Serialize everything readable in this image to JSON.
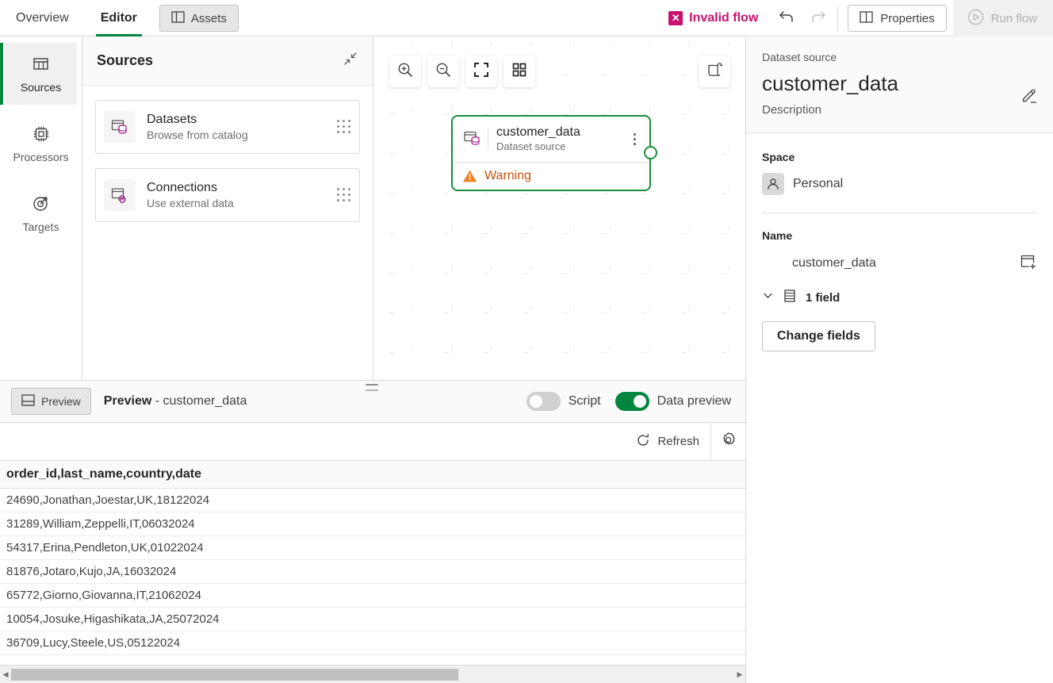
{
  "topbar": {
    "tabs": [
      {
        "label": "Overview",
        "active": false
      },
      {
        "label": "Editor",
        "active": true
      }
    ],
    "assets_label": "Assets",
    "invalid_flow_label": "Invalid flow",
    "invalid_flow_color": "#C8106E",
    "undo_label": "Undo",
    "redo_label": "Redo",
    "properties_label": "Properties",
    "run_flow_label": "Run flow"
  },
  "rail": {
    "items": [
      {
        "label": "Sources",
        "icon": "table-icon",
        "active": true
      },
      {
        "label": "Processors",
        "icon": "chip-icon",
        "active": false
      },
      {
        "label": "Targets",
        "icon": "target-icon",
        "active": false
      }
    ]
  },
  "sources_panel": {
    "title": "Sources",
    "collapse_label": "Collapse",
    "cards": [
      {
        "title": "Datasets",
        "subtitle": "Browse from catalog",
        "icon": "dataset-icon"
      },
      {
        "title": "Connections",
        "subtitle": "Use external data",
        "icon": "connection-icon"
      }
    ]
  },
  "canvas": {
    "toolbar": [
      {
        "name": "zoom-in-icon",
        "label": "Zoom in"
      },
      {
        "name": "zoom-out-icon",
        "label": "Zoom out"
      },
      {
        "name": "fit-screen-icon",
        "label": "Fit to screen"
      },
      {
        "name": "auto-layout-icon",
        "label": "Auto layout"
      }
    ],
    "script_button_label": "Script",
    "node": {
      "title": "customer_data",
      "subtitle": "Dataset source",
      "status": "Warning",
      "status_color": "#C4500F",
      "border_color": "#1A8C3C",
      "menu_label": "More options"
    }
  },
  "preview": {
    "tab_label": "Preview",
    "title_prefix": "Preview",
    "title_suffix": "- customer_data",
    "script_toggle_label": "Script",
    "script_toggle_on": false,
    "data_preview_toggle_label": "Data preview",
    "data_preview_toggle_on": true,
    "refresh_label": "Refresh",
    "settings_label": "Settings",
    "table": {
      "header": "order_id,last_name,country,date",
      "rows": [
        "24690,Jonathan,Joestar,UK,18122024",
        "31289,William,Zeppelli,IT,06032024",
        "54317,Erina,Pendleton,UK,01022024",
        "81876,Jotaro,Kujo,JA,16032024",
        "65772,Giorno,Giovanna,IT,21062024",
        "10054,Josuke,Higashikata,JA,25072024",
        "36709,Lucy,Steele,US,05122024"
      ]
    }
  },
  "properties": {
    "kicker": "Dataset source",
    "title": "customer_data",
    "description": "Description",
    "edit_label": "Edit",
    "space_label": "Space",
    "space_value": "Personal",
    "name_label": "Name",
    "name_value": "customer_data",
    "add_label": "Add",
    "fields_count_label": "1 field",
    "change_fields_label": "Change fields"
  },
  "colors": {
    "accent_green": "#00873D",
    "node_green": "#1A8C3C",
    "warning_orange": "#C4500F",
    "error_magenta": "#C8106E",
    "icon_magenta": "#A3248B"
  }
}
